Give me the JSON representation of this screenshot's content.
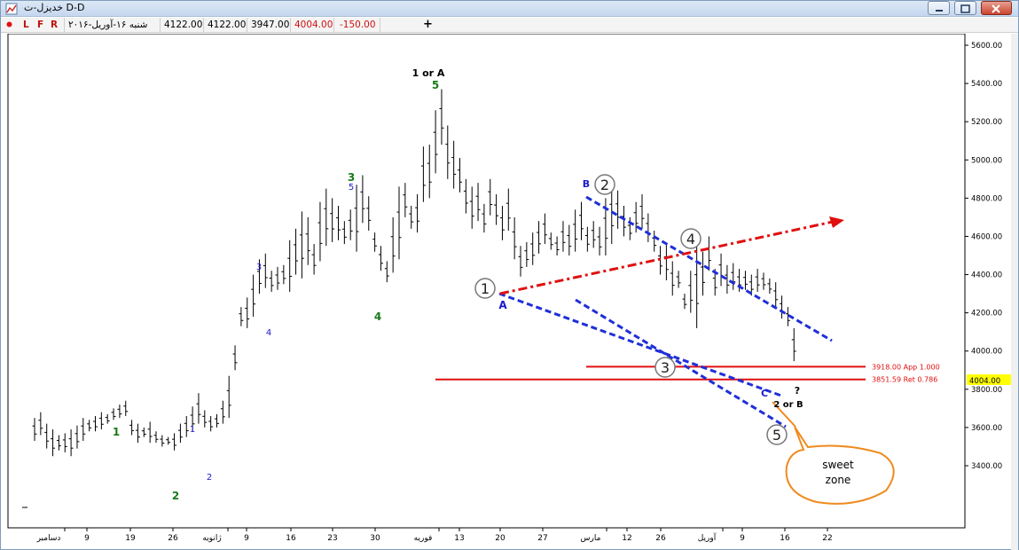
{
  "window": {
    "title": "خدیزل-ت D-D",
    "controls": [
      "minimize",
      "maximize",
      "close"
    ]
  },
  "toolbar": {
    "flags": [
      "L",
      "F",
      "R"
    ],
    "date": "شنبه ۱۶-آوریل-۲۰۱۶",
    "open": "4122.00",
    "high": "4122.00",
    "low": "3947.00",
    "close": "4004.00",
    "change": "-150.00",
    "add_label": "+"
  },
  "colors": {
    "bars": "#000000",
    "trend_blue": "#1f2fd8",
    "trend_red": "#e01010",
    "level_red": "#e01010",
    "price_tag": "#ffff00",
    "callout": "#f08a1e",
    "wave_green": "#1a7a1a",
    "wave_blue": "#1a1ad0"
  },
  "chart_data": {
    "type": "ohlc",
    "interval": "daily",
    "x_ticks": [
      "دسامبر",
      "9",
      "19",
      "26",
      "ژانویه",
      "9",
      "16",
      "23",
      "30",
      "فوریه",
      "13",
      "20",
      "27",
      "مارس",
      "12",
      "26",
      "آوریل",
      "9",
      "16",
      "22"
    ],
    "y_ticks": [
      "3400.00",
      "3600.00",
      "3800.00",
      "4000.00",
      "4200.00",
      "4400.00",
      "4600.00",
      "4800.00",
      "5000.00",
      "5200.00",
      "5400.00",
      "5600.00"
    ],
    "ylim": [
      3310,
      5710
    ],
    "last_price": "4004.00",
    "bars": [
      [
        3650,
        3530
      ],
      [
        3680,
        3560
      ],
      [
        3620,
        3490
      ],
      [
        3590,
        3450
      ],
      [
        3560,
        3480
      ],
      [
        3570,
        3470
      ],
      [
        3590,
        3450
      ],
      [
        3610,
        3490
      ],
      [
        3650,
        3530
      ],
      [
        3640,
        3580
      ],
      [
        3660,
        3580
      ],
      [
        3680,
        3590
      ],
      [
        3670,
        3620
      ],
      [
        3700,
        3640
      ],
      [
        3720,
        3650
      ],
      [
        3740,
        3660
      ],
      [
        3640,
        3560
      ],
      [
        3620,
        3520
      ],
      [
        3600,
        3550
      ],
      [
        3630,
        3520
      ],
      [
        3580,
        3520
      ],
      [
        3560,
        3500
      ],
      [
        3550,
        3510
      ],
      [
        3570,
        3480
      ],
      [
        3620,
        3520
      ],
      [
        3660,
        3550
      ],
      [
        3710,
        3580
      ],
      [
        3780,
        3620
      ],
      [
        3690,
        3600
      ],
      [
        3660,
        3580
      ],
      [
        3670,
        3600
      ],
      [
        3740,
        3620
      ],
      [
        3870,
        3650
      ],
      [
        4030,
        3900
      ],
      [
        4230,
        4130
      ],
      [
        4280,
        4120
      ],
      [
        4400,
        4180
      ],
      [
        4480,
        4300
      ],
      [
        4510,
        4330
      ],
      [
        4420,
        4310
      ],
      [
        4440,
        4320
      ],
      [
        4450,
        4350
      ],
      [
        4580,
        4310
      ],
      [
        4640,
        4400
      ],
      [
        4730,
        4380
      ],
      [
        4700,
        4450
      ],
      [
        4560,
        4400
      ],
      [
        4780,
        4470
      ],
      [
        4850,
        4550
      ],
      [
        4800,
        4570
      ],
      [
        4760,
        4580
      ],
      [
        4680,
        4560
      ],
      [
        4740,
        4580
      ],
      [
        4870,
        4520
      ],
      [
        4920,
        4670
      ],
      [
        4810,
        4630
      ],
      [
        4620,
        4520
      ],
      [
        4550,
        4420
      ],
      [
        4470,
        4360
      ],
      [
        4700,
        4410
      ],
      [
        4860,
        4480
      ],
      [
        4880,
        4700
      ],
      [
        4760,
        4640
      ],
      [
        4820,
        4620
      ],
      [
        5070,
        4780
      ],
      [
        5080,
        4800
      ],
      [
        5260,
        4930
      ],
      [
        5370,
        5080
      ],
      [
        5180,
        4900
      ],
      [
        5100,
        4850
      ],
      [
        5010,
        4830
      ],
      [
        4900,
        4720
      ],
      [
        4860,
        4640
      ],
      [
        4880,
        4680
      ],
      [
        4770,
        4620
      ],
      [
        4900,
        4710
      ],
      [
        4820,
        4660
      ],
      [
        4760,
        4580
      ],
      [
        4850,
        4630
      ],
      [
        4700,
        4480
      ],
      [
        4550,
        4390
      ],
      [
        4570,
        4440
      ],
      [
        4620,
        4450
      ],
      [
        4680,
        4510
      ],
      [
        4720,
        4560
      ],
      [
        4620,
        4530
      ],
      [
        4600,
        4500
      ],
      [
        4680,
        4520
      ],
      [
        4660,
        4500
      ],
      [
        4740,
        4520
      ],
      [
        4780,
        4580
      ],
      [
        4650,
        4520
      ],
      [
        4680,
        4540
      ],
      [
        4650,
        4500
      ],
      [
        4800,
        4500
      ],
      [
        4880,
        4560
      ],
      [
        4840,
        4640
      ],
      [
        4760,
        4600
      ],
      [
        4700,
        4580
      ],
      [
        4780,
        4620
      ],
      [
        4820,
        4640
      ],
      [
        4720,
        4570
      ],
      [
        4630,
        4520
      ],
      [
        4550,
        4400
      ],
      [
        4560,
        4370
      ],
      [
        4470,
        4290
      ],
      [
        4420,
        4330
      ],
      [
        4300,
        4220
      ],
      [
        4420,
        4200
      ],
      [
        4550,
        4120
      ],
      [
        4520,
        4290
      ],
      [
        4600,
        4420
      ],
      [
        4430,
        4290
      ],
      [
        4510,
        4340
      ],
      [
        4450,
        4300
      ],
      [
        4460,
        4320
      ],
      [
        4430,
        4310
      ],
      [
        4420,
        4320
      ],
      [
        4400,
        4290
      ],
      [
        4430,
        4310
      ],
      [
        4410,
        4320
      ],
      [
        4380,
        4300
      ],
      [
        4360,
        4230
      ],
      [
        4290,
        4170
      ],
      [
        4230,
        4130
      ],
      [
        4120,
        3947
      ]
    ],
    "levels": [
      {
        "label": "3918.00 App 1.000",
        "value": 3918
      },
      {
        "label": "3851.59 Ret 0.786",
        "value": 3851.59
      }
    ],
    "wave_labels": [
      {
        "text": "1",
        "color": "green"
      },
      {
        "text": "2",
        "color": "green"
      },
      {
        "text": "1",
        "color": "blue"
      },
      {
        "text": "2",
        "color": "blue"
      },
      {
        "text": "3",
        "color": "blue"
      },
      {
        "text": "4",
        "color": "blue"
      },
      {
        "text": "3",
        "color": "green"
      },
      {
        "text": "5",
        "color": "blue"
      },
      {
        "text": "4",
        "color": "green"
      },
      {
        "text": "1 or A",
        "color": "black"
      },
      {
        "text": "5",
        "color": "green"
      },
      {
        "text": "A",
        "color": "blue"
      },
      {
        "text": "B",
        "color": "blue"
      },
      {
        "text": "C",
        "color": "blue"
      },
      {
        "text": "?",
        "color": "black"
      },
      {
        "text": "2 or B",
        "color": "black"
      }
    ],
    "circled_labels": [
      "1",
      "2",
      "3",
      "4",
      "5"
    ],
    "callout": "sweet\nzone"
  }
}
